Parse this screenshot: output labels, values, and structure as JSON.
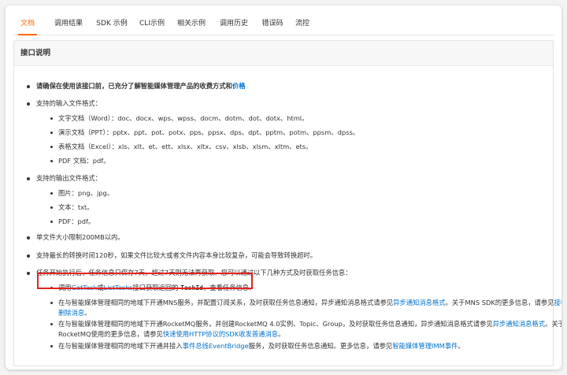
{
  "tabs": [
    "文档",
    "调用结果",
    "SDK 示例",
    "CLI示例",
    "相关示例",
    "调用历史",
    "错误码",
    "流控"
  ],
  "panel_title": "接口说明",
  "intro": {
    "text": "请确保在使用该接口前，已充分了解智能媒体管理产品的收费方式和",
    "link": "价格"
  },
  "input_title": "支持的输入文件格式：",
  "input_formats": [
    "文字文档（Word）：doc、docx、wps、wpss、docm、dotm、dot、dotx、html。",
    "演示文档（PPT）：pptx、ppt、pot、potx、pps、ppsx、dps、dpt、pptm、potm、ppsm、dpss。",
    "表格文档（Excel）：xls、xlt、et、ett、xlsx、xltx、csv、xlsb、xlsm、xltm、ets。",
    "PDF 文档：pdf。"
  ],
  "output_title": "支持的输出文件格式：",
  "output_formats": [
    "图片：png、jpg。",
    "文本：txt。",
    "PDF：pdf。"
  ],
  "size_limit": "单文件大小限制200MB以内。",
  "time_limit": "支持最长的转换时间120秒，如果文件比较大或者文件内容本身比较复杂，可能会导致转换超时。",
  "task_intro": "任务开始执行后，任务信息只保存7天，超过7天则无法再获取。您可以通过以下几种方式及时获取任务信息：",
  "task_ways": {
    "w1": {
      "a": "调用",
      "l1": "GetTask",
      "b": "或",
      "l2": "ListTasks",
      "c": "接口获取返回的",
      "code": "TaskId",
      "d": "，查看任务信息。"
    },
    "w2": {
      "a": "在与智能媒体管理相同的地域下开通MNS服务，并配置订阅关系，及时获取任务信息通知，异步通知消息格式请参见",
      "l1": "异步通知消息格式",
      "b": "。关于MNS SDK的更多信息，请参见",
      "l2": "接收和",
      "l3": "删除消息",
      "c": "。"
    },
    "w3": {
      "a": "在与智能媒体管理相同的地域下开通RocketMQ服务，并创建RocketMQ 4.0实例、Topic、Group，及时获取任务信息通知，异步通知消息格式请参见",
      "l1": "异步通知消息格式",
      "b": "。关于",
      "c": "RocketMQ使用的更多信息，请参见",
      "l2": "快速使用HTTP协议的SDK收发普通消息",
      "d": "。"
    },
    "w4": {
      "a": "在与智能媒体管理相同的地域下开通并接入",
      "l1": "事件总线EventBridge",
      "b": "服务，及时获取任务信息通知。更多信息，请参见",
      "l2": "智能媒体管理IMM事件",
      "c": "。"
    }
  },
  "colors": {
    "accent": "#ff6a00",
    "link": "#0070cc",
    "highlight": "#e3231d"
  }
}
